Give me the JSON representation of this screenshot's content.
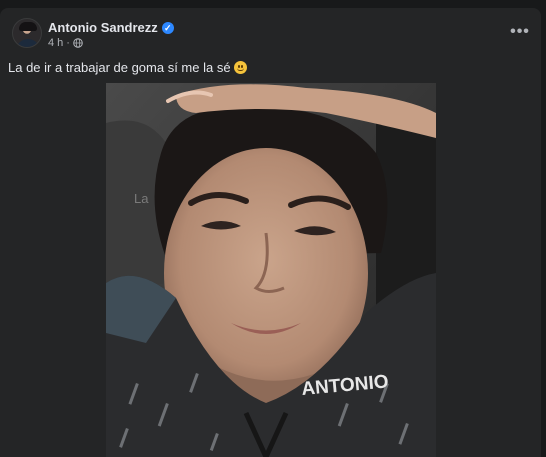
{
  "post": {
    "author": "Antonio Sandrezz",
    "time": "4 h",
    "separator": "·",
    "caption": "La de ir a trabajar de goma sí me la sé",
    "more_label": "•••",
    "photo": {
      "shirt_text": "ANTONIO"
    }
  }
}
